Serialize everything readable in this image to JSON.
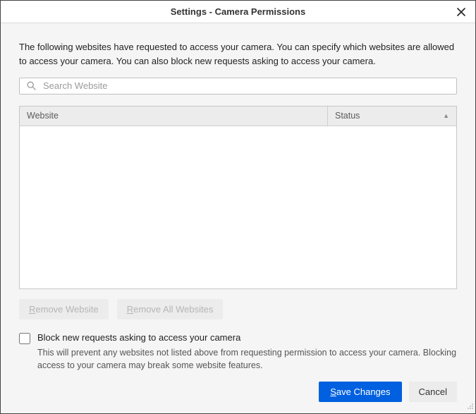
{
  "title": "Settings - Camera Permissions",
  "intro": "The following websites have requested to access your camera. You can specify which websites are allowed to access your camera. You can also block new requests asking to access your camera.",
  "search": {
    "placeholder": "Search Website"
  },
  "table": {
    "headers": {
      "website": "Website",
      "status": "Status"
    },
    "rows": []
  },
  "buttons": {
    "remove_website_prefix": "R",
    "remove_website_rest": "emove Website",
    "remove_all_prefix": "R",
    "remove_all_rest": "emove All Websites",
    "save_prefix": "S",
    "save_rest": "ave Changes",
    "cancel": "Cancel"
  },
  "block": {
    "label": "Block new requests asking to access your camera",
    "desc": "This will prevent any websites not listed above from requesting permission to access your camera. Blocking access to your camera may break some website features."
  }
}
